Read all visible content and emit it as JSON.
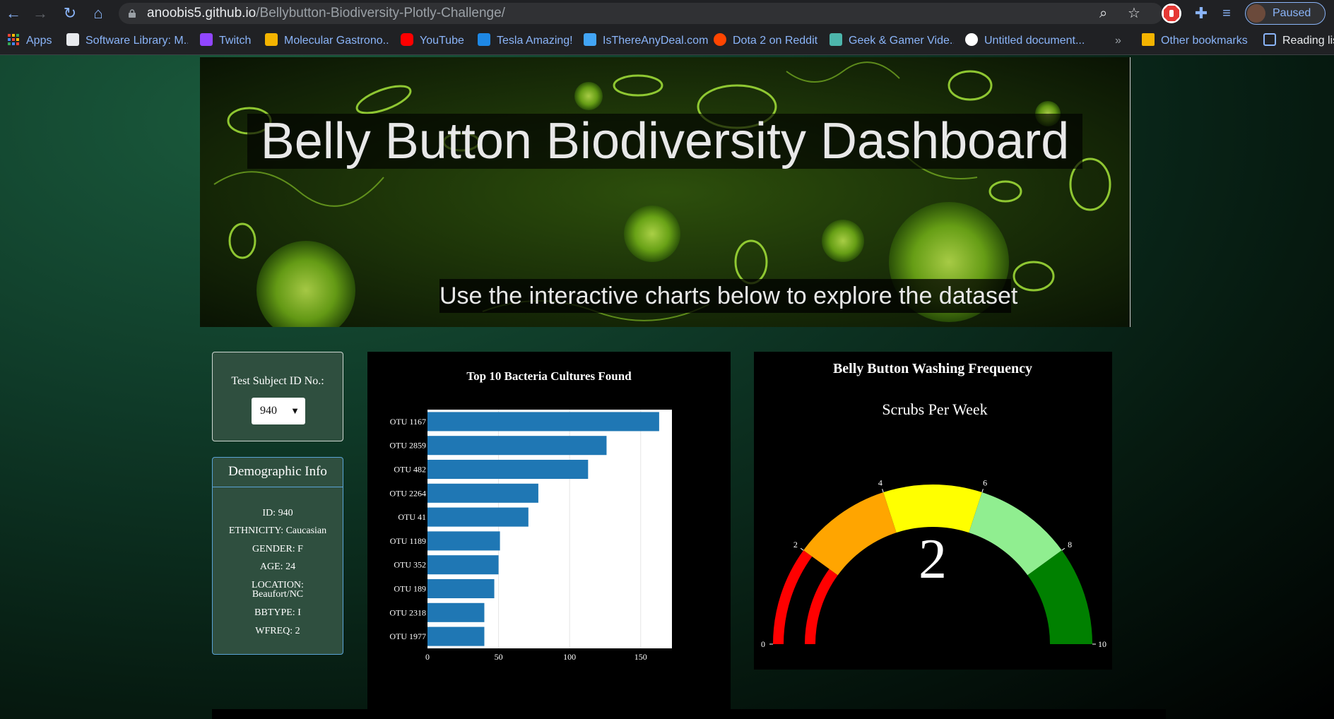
{
  "browser": {
    "url_host": "anoobis5.github.io",
    "url_path": "/Bellybutton-Biodiversity-Plotly-Challenge/",
    "profile_label": "Paused",
    "bookmarks": [
      {
        "label": "Apps",
        "icon": "apps-grid-icon",
        "color": "#ea4335"
      },
      {
        "label": "Software Library: M...",
        "icon": "library-icon",
        "color": "#e8eaed"
      },
      {
        "label": "Twitch",
        "icon": "twitch-icon",
        "color": "#9146ff"
      },
      {
        "label": "Molecular Gastrono...",
        "icon": "bookmark-site-icon",
        "color": "#f4b400"
      },
      {
        "label": "YouTube",
        "icon": "youtube-icon",
        "color": "#ff0000"
      },
      {
        "label": "Tesla Amazing!",
        "icon": "tumblr-icon",
        "color": "#1e88e5"
      },
      {
        "label": "IsThereAnyDeal.com",
        "icon": "deal-icon",
        "color": "#42a5f5"
      },
      {
        "label": "Dota 2 on Reddit",
        "icon": "reddit-icon",
        "color": "#ff4500"
      },
      {
        "label": "Geek & Gamer Vide...",
        "icon": "gamer-icon",
        "color": "#4db6ac"
      },
      {
        "label": "Untitled document...",
        "icon": "google-icon",
        "color": "#4285f4"
      }
    ],
    "overflow_label": "»",
    "other_bookmarks": "Other bookmarks",
    "reading_list": "Reading lis"
  },
  "header": {
    "title": "Belly Button Biodiversity Dashboard",
    "subtitle": "Use the interactive charts below to explore the dataset"
  },
  "selector": {
    "label": "Test Subject ID No.:",
    "value": "940"
  },
  "demographics": {
    "title": "Demographic Info",
    "rows": [
      "ID: 940",
      "ETHNICITY: Caucasian",
      "GENDER: F",
      "AGE: 24",
      "LOCATION:",
      "Beaufort/NC",
      "BBTYPE: I",
      "WFREQ: 2"
    ]
  },
  "chart_data": [
    {
      "type": "bar",
      "orientation": "horizontal",
      "title": "Top 10 Bacteria Cultures Found",
      "categories": [
        "OTU 1167",
        "OTU 2859",
        "OTU 482",
        "OTU 2264",
        "OTU 41",
        "OTU 1189",
        "OTU 352",
        "OTU 189",
        "OTU 2318",
        "OTU 1977"
      ],
      "values": [
        163,
        126,
        113,
        78,
        71,
        51,
        50,
        47,
        40,
        40
      ],
      "xlim": [
        0,
        172
      ],
      "xticks": [
        0,
        50,
        100,
        150
      ],
      "bar_color": "#1f77b4",
      "grid": true
    },
    {
      "type": "gauge",
      "title": "Belly Button Washing Frequency",
      "subtitle": "Scrubs Per Week",
      "value": 2,
      "range": [
        0,
        10
      ],
      "ticks": [
        0,
        2,
        4,
        6,
        8,
        10
      ],
      "steps": [
        {
          "range": [
            0,
            2
          ],
          "color": "#ff0000"
        },
        {
          "range": [
            2,
            4
          ],
          "color": "#ffa500"
        },
        {
          "range": [
            4,
            6
          ],
          "color": "#ffff00"
        },
        {
          "range": [
            6,
            8
          ],
          "color": "#90ee90"
        },
        {
          "range": [
            8,
            10
          ],
          "color": "#008000"
        }
      ],
      "bar_color": "#ff0000"
    }
  ]
}
